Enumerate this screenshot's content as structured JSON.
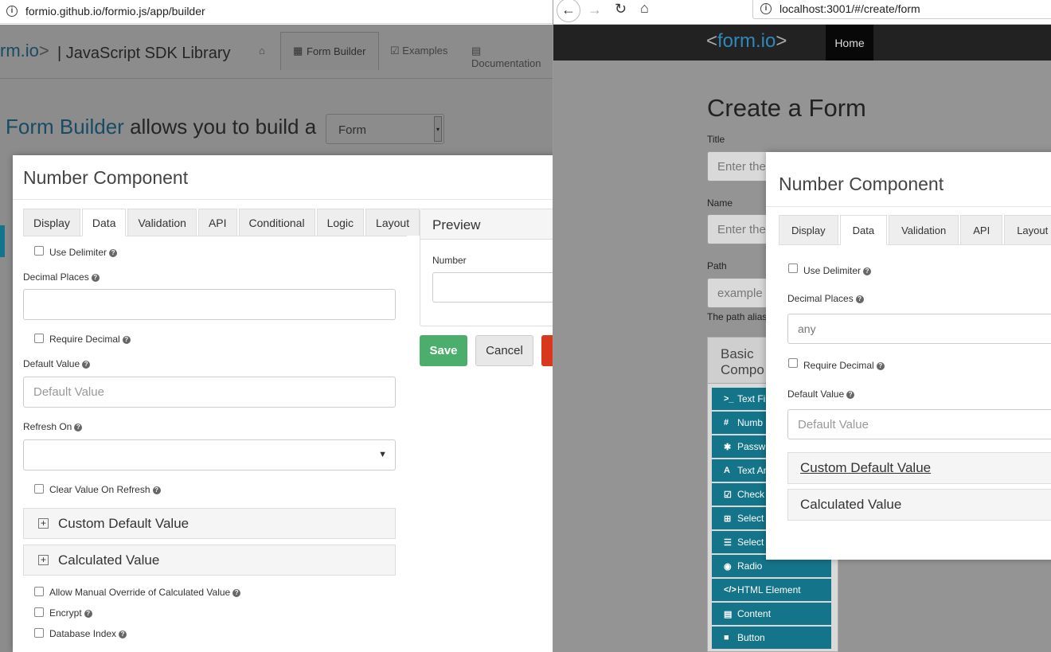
{
  "left_window": {
    "url": "formio.github.io/formio.js/app/builder",
    "brand_suffix": "rm.io",
    "brand_gt": ">",
    "site_title": "| JavaScript SDK Library",
    "nav": [
      "Form Builder",
      "Examples",
      "Documentation"
    ],
    "heading_highlight": "Form Builder",
    "heading_rest": "allows you to build a",
    "heading_select": "Form",
    "modal": {
      "title": "Number Component",
      "tabs": [
        "Display",
        "Data",
        "Validation",
        "API",
        "Conditional",
        "Logic",
        "Layout"
      ],
      "active_tab": "Data",
      "use_delimiter": "Use Delimiter",
      "decimal_places": "Decimal Places",
      "require_decimal": "Require Decimal",
      "default_value_label": "Default Value",
      "default_value_placeholder": "Default Value",
      "refresh_on": "Refresh On",
      "clear_value": "Clear Value On Refresh",
      "custom_default": "Custom Default Value",
      "calculated": "Calculated Value",
      "allow_override": "Allow Manual Override of Calculated Value",
      "encrypt": "Encrypt",
      "db_index": "Database Index",
      "preview_title": "Preview",
      "preview_number": "Number",
      "save": "Save",
      "cancel": "Cancel"
    }
  },
  "right_window": {
    "url": "localhost:3001/#/create/form",
    "brand": "form.io",
    "brand_lt": "<",
    "brand_gt": ">",
    "nav_home": "Home",
    "page_title": "Create a Form",
    "title_label": "Title",
    "title_placeholder": "Enter the",
    "name_label": "Name",
    "name_placeholder": "Enter the",
    "path_label": "Path",
    "path_placeholder": "example",
    "path_help": "The path alias",
    "basic_components": [
      "Basic",
      "Compo"
    ],
    "components": [
      {
        "icon": ">_",
        "label": "Text Fi"
      },
      {
        "icon": "#",
        "label": "Numb"
      },
      {
        "icon": "✱",
        "label": "Passw"
      },
      {
        "icon": "A",
        "label": "Text Ar"
      },
      {
        "icon": "☑",
        "label": "Check"
      },
      {
        "icon": "⊞",
        "label": "Select"
      },
      {
        "icon": "☰",
        "label": "Select"
      },
      {
        "icon": "◉",
        "label": "Radio"
      },
      {
        "icon": "</>",
        "label": "HTML Element"
      },
      {
        "icon": "▤",
        "label": "Content"
      },
      {
        "icon": "■",
        "label": "Button"
      }
    ],
    "modal": {
      "title": "Number Component",
      "tabs": [
        "Display",
        "Data",
        "Validation",
        "API",
        "Layout"
      ],
      "active_tab": "Data",
      "use_delimiter": "Use Delimiter",
      "decimal_places": "Decimal Places",
      "decimal_value": "any",
      "require_decimal": "Require Decimal",
      "default_value_label": "Default Value",
      "default_value_placeholder": "Default Value",
      "custom_default": "Custom Default Value",
      "calculated": "Calculated Value"
    }
  },
  "colors": {
    "formio_blue": "#2f89b8",
    "save_green": "#4cae6c",
    "component_teal": "#147489",
    "header_dark": "#222222"
  }
}
